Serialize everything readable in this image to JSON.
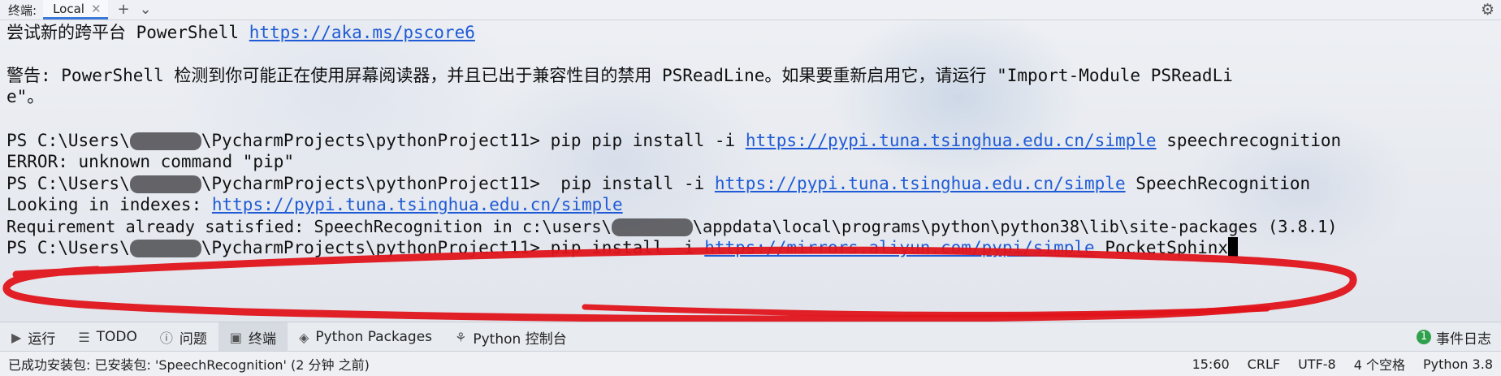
{
  "tabbar": {
    "title": "终端:",
    "active_tab": "Local",
    "close_glyph": "✕",
    "add_glyph": "+",
    "dropdown_glyph": "⌄",
    "settings_icon": "gear-icon"
  },
  "terminal": {
    "line1_text": "尝试新的跨平台 PowerShell ",
    "line1_link": "https://aka.ms/pscore6",
    "line2": "警告: PowerShell 检测到你可能正在使用屏幕阅读器，并且已出于兼容性目的禁用 PSReadLine。如果要重新启用它，请运行 \"Import-Module PSReadLi",
    "line3": "e\"。",
    "cmd1_prefix": "PS C:\\Users\\",
    "cmd1_path": "\\PycharmProjects\\pythonProject11> pip pip install -i ",
    "cmd1_link": "https://pypi.tuna.tsinghua.edu.cn/simple",
    "cmd1_suffix": " speechrecognition",
    "err": "ERROR: unknown command \"pip\"",
    "cmd2_prefix": "PS C:\\Users\\",
    "cmd2_path": "\\PycharmProjects\\pythonProject11>  pip install -i ",
    "cmd2_link": "https://pypi.tuna.tsinghua.edu.cn/simple",
    "cmd2_suffix": " SpeechRecognition",
    "looking_text": "Looking in indexes: ",
    "looking_link": "https://pypi.tuna.tsinghua.edu.cn/simple",
    "req_line": "Requirement already satisfied: SpeechRecognition in c:\\users\\",
    "req_tail": "\\appdata\\local\\programs\\python\\python38\\lib\\site-packages (3.8.1)",
    "cmd3_prefix": "PS C:\\Users\\",
    "cmd3_path": "\\PycharmProjects\\pythonProject11> pip install -i ",
    "cmd3_link": "https://mirrors.aliyun.com/pypi/simple",
    "cmd3_suffix": " PocketSphinx"
  },
  "toolwindows": [
    {
      "label": "运行",
      "icon": "play-icon"
    },
    {
      "label": "TODO",
      "icon": "list-icon"
    },
    {
      "label": "问题",
      "icon": "info-icon"
    },
    {
      "label": "终端",
      "icon": "terminal-icon"
    },
    {
      "label": "Python Packages",
      "icon": "layers-icon"
    },
    {
      "label": "Python 控制台",
      "icon": "python-icon"
    }
  ],
  "events": {
    "count": "1",
    "label": "事件日志"
  },
  "statusbar": {
    "message": "已成功安装包: 已安装包: 'SpeechRecognition' (2 分钟 之前)",
    "position": "15:60",
    "line_sep": "CRLF",
    "encoding": "UTF-8",
    "indent": "4 个空格",
    "interpreter": "Python 3.8"
  },
  "colors": {
    "link": "#1f5bd6",
    "annotation": "#e0141b",
    "active_tab": "#3b79d8"
  }
}
